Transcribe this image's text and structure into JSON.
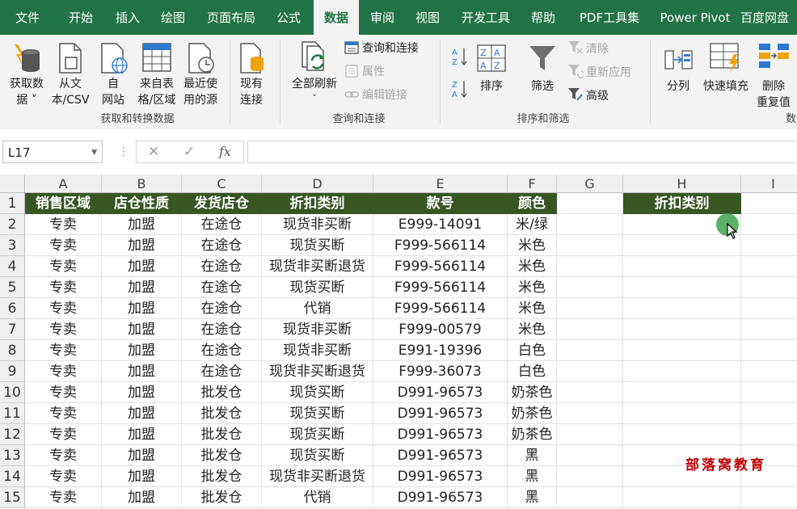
{
  "ribbon_tabs": [
    "文件",
    "开始",
    "插入",
    "绘图",
    "页面布局",
    "公式",
    "数据",
    "审阅",
    "视图",
    "开发工具",
    "帮助",
    "PDF工具集",
    "Power Pivot",
    "百度网盘"
  ],
  "active_tab": "数据",
  "ribbon": {
    "get_data": {
      "line1": "获取数",
      "line2": "据 ˅"
    },
    "from_text": {
      "line1": "从文",
      "line2": "本/CSV"
    },
    "from_web": {
      "line1": "自",
      "line2": "网站"
    },
    "from_table": {
      "line1": "来自表",
      "line2": "格/区域"
    },
    "recent": {
      "line1": "最近使",
      "line2": "用的源"
    },
    "existing": {
      "line1": "现有",
      "line2": "连接"
    },
    "group1_label": "获取和转换数据",
    "refresh_all": {
      "line1": "全部刷新",
      "line2": "˅"
    },
    "queries_connections": "查询和连接",
    "properties": "属性",
    "edit_links": "编辑链接",
    "group2_label": "查询和连接",
    "sort": "排序",
    "filter": "筛选",
    "clear": "清除",
    "reapply": "重新应用",
    "advanced": "高级",
    "group3_label": "排序和筛选",
    "text_to_columns": "分列",
    "flash_fill": "快速填充",
    "remove_dup": {
      "line1": "删除",
      "line2": "重复值"
    },
    "group4_label": "数"
  },
  "formula_bar": {
    "name_box": "L17",
    "cancel_symbol": "✕",
    "enter_symbol": "✓",
    "fx_symbol": "fx",
    "formula": ""
  },
  "columns": [
    "A",
    "B",
    "C",
    "D",
    "E",
    "F",
    "G",
    "H",
    "I"
  ],
  "row_numbers": [
    "1",
    "2",
    "3",
    "4",
    "5",
    "6",
    "7",
    "8",
    "9",
    "10",
    "11",
    "12",
    "13",
    "14",
    "15"
  ],
  "table_headers": [
    "销售区域",
    "店仓性质",
    "发货店仓",
    "折扣类别",
    "款号",
    "颜色"
  ],
  "h_header": "折扣类别",
  "rows": [
    [
      "专卖",
      "加盟",
      "在途仓",
      "现货非买断",
      "E999-14091",
      "米/绿"
    ],
    [
      "专卖",
      "加盟",
      "在途仓",
      "现货买断",
      "F999-566114",
      "米色"
    ],
    [
      "专卖",
      "加盟",
      "在途仓",
      "现货非买断退货",
      "F999-566114",
      "米色"
    ],
    [
      "专卖",
      "加盟",
      "在途仓",
      "现货买断",
      "F999-566114",
      "米色"
    ],
    [
      "专卖",
      "加盟",
      "在途仓",
      "代销",
      "F999-566114",
      "米色"
    ],
    [
      "专卖",
      "加盟",
      "在途仓",
      "现货非买断",
      "F999-00579",
      "米色"
    ],
    [
      "专卖",
      "加盟",
      "在途仓",
      "现货非买断",
      "E991-19396",
      "白色"
    ],
    [
      "专卖",
      "加盟",
      "在途仓",
      "现货非买断退货",
      "F999-36073",
      "白色"
    ],
    [
      "专卖",
      "加盟",
      "批发仓",
      "现货买断",
      "D991-96573",
      "奶茶色"
    ],
    [
      "专卖",
      "加盟",
      "批发仓",
      "现货买断",
      "D991-96573",
      "奶茶色"
    ],
    [
      "专卖",
      "加盟",
      "批发仓",
      "现货买断",
      "D991-96573",
      "奶茶色"
    ],
    [
      "专卖",
      "加盟",
      "批发仓",
      "现货买断",
      "D991-96573",
      "黑"
    ],
    [
      "专卖",
      "加盟",
      "批发仓",
      "现货非买断退货",
      "D991-96573",
      "黑"
    ],
    [
      "专卖",
      "加盟",
      "批发仓",
      "代销",
      "D991-96573",
      "黑"
    ]
  ],
  "watermark": "部落窝教育",
  "colors": {
    "tab_bar": "#217346",
    "header_fill": "#375623",
    "watermark": "#c00000"
  }
}
